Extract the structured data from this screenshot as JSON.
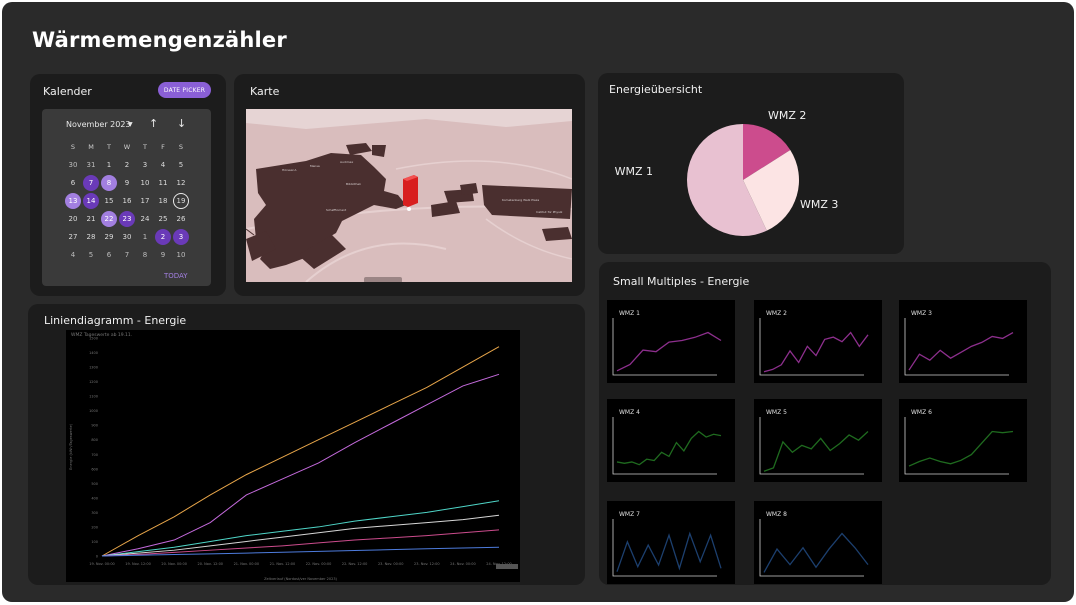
{
  "app": {
    "title": "Wärmemengenzähler"
  },
  "calendar": {
    "title": "Kalender",
    "date_picker_label": "DATE PICKER",
    "month_label": "November 2023",
    "dropdown_icon": "caret-down-icon",
    "prev_icon": "arrow-up-icon",
    "next_icon": "arrow-down-icon",
    "weekdays": [
      "S",
      "M",
      "T",
      "W",
      "T",
      "F",
      "S"
    ],
    "weeks": [
      [
        "30",
        "31",
        "1",
        "2",
        "3",
        "4",
        "5"
      ],
      [
        "6",
        "7",
        "8",
        "9",
        "10",
        "11",
        "12"
      ],
      [
        "13",
        "14",
        "15",
        "16",
        "17",
        "18",
        "19"
      ],
      [
        "20",
        "21",
        "22",
        "23",
        "24",
        "25",
        "26"
      ],
      [
        "27",
        "28",
        "29",
        "30",
        "1",
        "2",
        "3"
      ],
      [
        "4",
        "5",
        "6",
        "7",
        "8",
        "9",
        "10"
      ]
    ],
    "today_label": "TODAY",
    "accent_color": "#8a5fd6"
  },
  "map": {
    "title": "Karte",
    "labels": [
      "Hörsaal A",
      "Mensa",
      "Audimax",
      "Bibliothek",
      "Schafftomant",
      "Kometenberg Walk Plaza",
      "Institut für Physik"
    ]
  },
  "pie": {
    "title": "Energieübersicht",
    "chart_data": {
      "type": "pie",
      "categories": [
        "WMZ 1",
        "WMZ 2",
        "WMZ 3"
      ],
      "values": [
        57,
        16,
        27
      ],
      "colors": [
        "#e8c1d1",
        "#cc4c8d",
        "#fce4e4"
      ]
    }
  },
  "line": {
    "title": "Liniendiagramm - Energie",
    "inner_title": "WMZ Tageswerte ab 19.11.",
    "ylabel": "Energie (kWh/Tageswerte)",
    "xlabel": "Zeitverlauf (Nordost/ver November 2023)",
    "chart_data": {
      "type": "line",
      "x": [
        "19. Nov. 00:00",
        "19. Nov. 12:00",
        "20. Nov. 00:00",
        "20. Nov. 12:00",
        "21. Nov. 00:00",
        "21. Nov. 12:00",
        "22. Nov. 00:00",
        "22. Nov. 12:00",
        "23. Nov. 00:00",
        "23. Nov. 12:00",
        "24. Nov. 00:00",
        "24. Nov. 12:00"
      ],
      "yticks": [
        "0",
        "100",
        "200",
        "300",
        "400",
        "500",
        "600",
        "700",
        "800",
        "900",
        "1000",
        "1100",
        "1200",
        "1300",
        "1400",
        "1500"
      ],
      "ylim": [
        0,
        1500
      ],
      "series": [
        {
          "color": "#e8a64a",
          "values": [
            0,
            140,
            270,
            420,
            560,
            680,
            800,
            920,
            1040,
            1160,
            1300,
            1440
          ]
        },
        {
          "color": "#c46adc",
          "values": [
            0,
            50,
            110,
            230,
            420,
            530,
            640,
            780,
            910,
            1040,
            1170,
            1250
          ]
        },
        {
          "color": "#4fd6c8",
          "values": [
            0,
            30,
            60,
            100,
            140,
            170,
            200,
            240,
            270,
            300,
            340,
            380
          ]
        },
        {
          "color": "#d6d6d6",
          "values": [
            0,
            20,
            40,
            70,
            100,
            130,
            160,
            190,
            210,
            230,
            250,
            280
          ]
        },
        {
          "color": "#cc4c8d",
          "values": [
            0,
            10,
            25,
            40,
            55,
            70,
            90,
            110,
            125,
            140,
            160,
            180
          ]
        },
        {
          "color": "#4d7bdc",
          "values": [
            0,
            5,
            10,
            15,
            20,
            26,
            32,
            38,
            44,
            50,
            55,
            60
          ]
        }
      ]
    }
  },
  "small_multiples": {
    "title": "Small Multiples - Energie",
    "chart_data": [
      {
        "type": "line",
        "name": "WMZ 1",
        "color": "#8d2f8d",
        "values": [
          2,
          6,
          15,
          14,
          20,
          21,
          23,
          26,
          21
        ]
      },
      {
        "type": "line",
        "name": "WMZ 2",
        "color": "#8d2f8d",
        "values": [
          1,
          2,
          4,
          10,
          5,
          12,
          8,
          15,
          16,
          14,
          18,
          12,
          17
        ]
      },
      {
        "type": "line",
        "name": "WMZ 3",
        "color": "#8d2f8d",
        "values": [
          2,
          10,
          7,
          12,
          8,
          11,
          14,
          16,
          19,
          18,
          21
        ]
      },
      {
        "type": "line",
        "name": "WMZ 4",
        "color": "#1f6b1f",
        "values": [
          8,
          7,
          8,
          6,
          10,
          9,
          15,
          12,
          22,
          16,
          25,
          30,
          26,
          28,
          27
        ]
      },
      {
        "type": "line",
        "name": "WMZ  5",
        "color": "#1f6b1f",
        "values": [
          1,
          3,
          18,
          12,
          16,
          14,
          20,
          13,
          17,
          22,
          19,
          24
        ]
      },
      {
        "type": "line",
        "name": "WMZ 6",
        "color": "#1f6b1f",
        "values": [
          6,
          10,
          13,
          10,
          8,
          11,
          16,
          26,
          36,
          35,
          36
        ]
      },
      {
        "type": "line",
        "name": "WMZ 7",
        "color": "#1c3f6e",
        "values": [
          2,
          20,
          5,
          18,
          6,
          24,
          4,
          25,
          8,
          24,
          4
        ]
      },
      {
        "type": "line",
        "name": "WMZ 8",
        "color": "#1c3f6e",
        "values": [
          2,
          20,
          8,
          21,
          6,
          20,
          32,
          21,
          8
        ]
      }
    ]
  }
}
